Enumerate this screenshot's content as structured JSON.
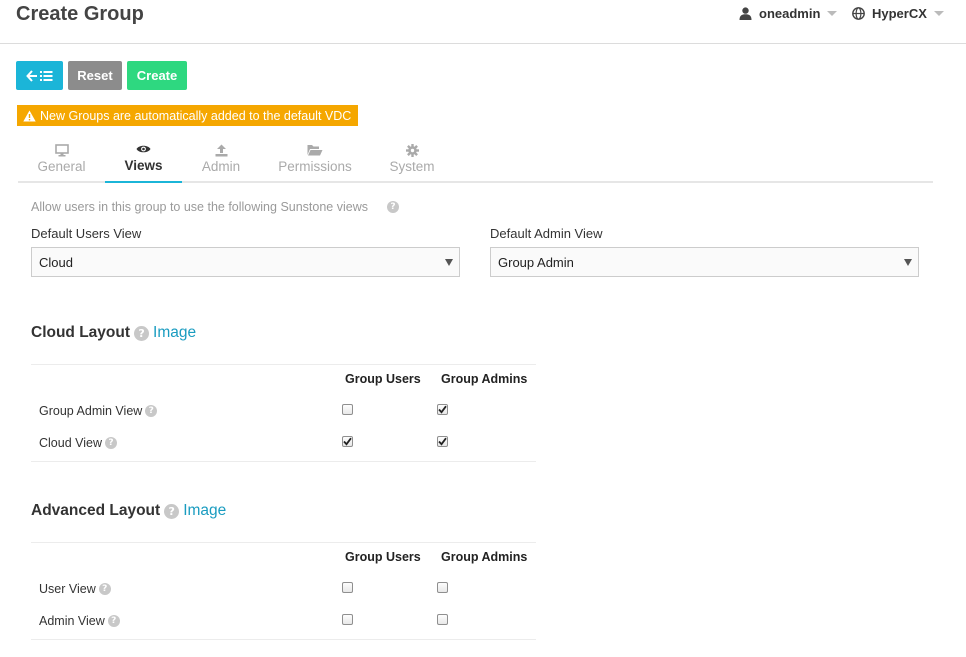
{
  "header": {
    "title": "Create Group",
    "user": "oneadmin",
    "zone": "HyperCX"
  },
  "toolbar": {
    "back_icon": "back-list-icon",
    "reset_label": "Reset",
    "create_label": "Create"
  },
  "warning": {
    "text": "New Groups are automatically added to the default VDC",
    "color": "#f5a700"
  },
  "tabs": [
    {
      "label": "General",
      "icon": "monitor-icon",
      "active": false
    },
    {
      "label": "Views",
      "icon": "eye-icon",
      "active": true
    },
    {
      "label": "Admin",
      "icon": "upload-icon",
      "active": false
    },
    {
      "label": "Permissions",
      "icon": "folder-open-icon",
      "active": false
    },
    {
      "label": "System",
      "icon": "gear-icon",
      "active": false
    }
  ],
  "views": {
    "hint": "Allow users in this group to use the following Sunstone views",
    "default_users_view": {
      "label": "Default Users View",
      "value": "Cloud"
    },
    "default_admin_view": {
      "label": "Default Admin View",
      "value": "Group Admin"
    }
  },
  "cloud_layout": {
    "title": "Cloud Layout",
    "image_link": "Image",
    "col_users": "Group Users",
    "col_admins": "Group Admins",
    "rows": [
      {
        "label": "Group Admin View",
        "users": false,
        "admins": true
      },
      {
        "label": "Cloud View",
        "users": true,
        "admins": true
      }
    ]
  },
  "advanced_layout": {
    "title": "Advanced Layout",
    "image_link": "Image",
    "col_users": "Group Users",
    "col_admins": "Group Admins",
    "rows": [
      {
        "label": "User View",
        "users": false,
        "admins": false
      },
      {
        "label": "Admin View",
        "users": false,
        "admins": false
      }
    ]
  },
  "colors": {
    "accent": "#1bb5d8",
    "create": "#2ed880",
    "reset": "#8c8c8c",
    "link": "#1a9cc0"
  }
}
